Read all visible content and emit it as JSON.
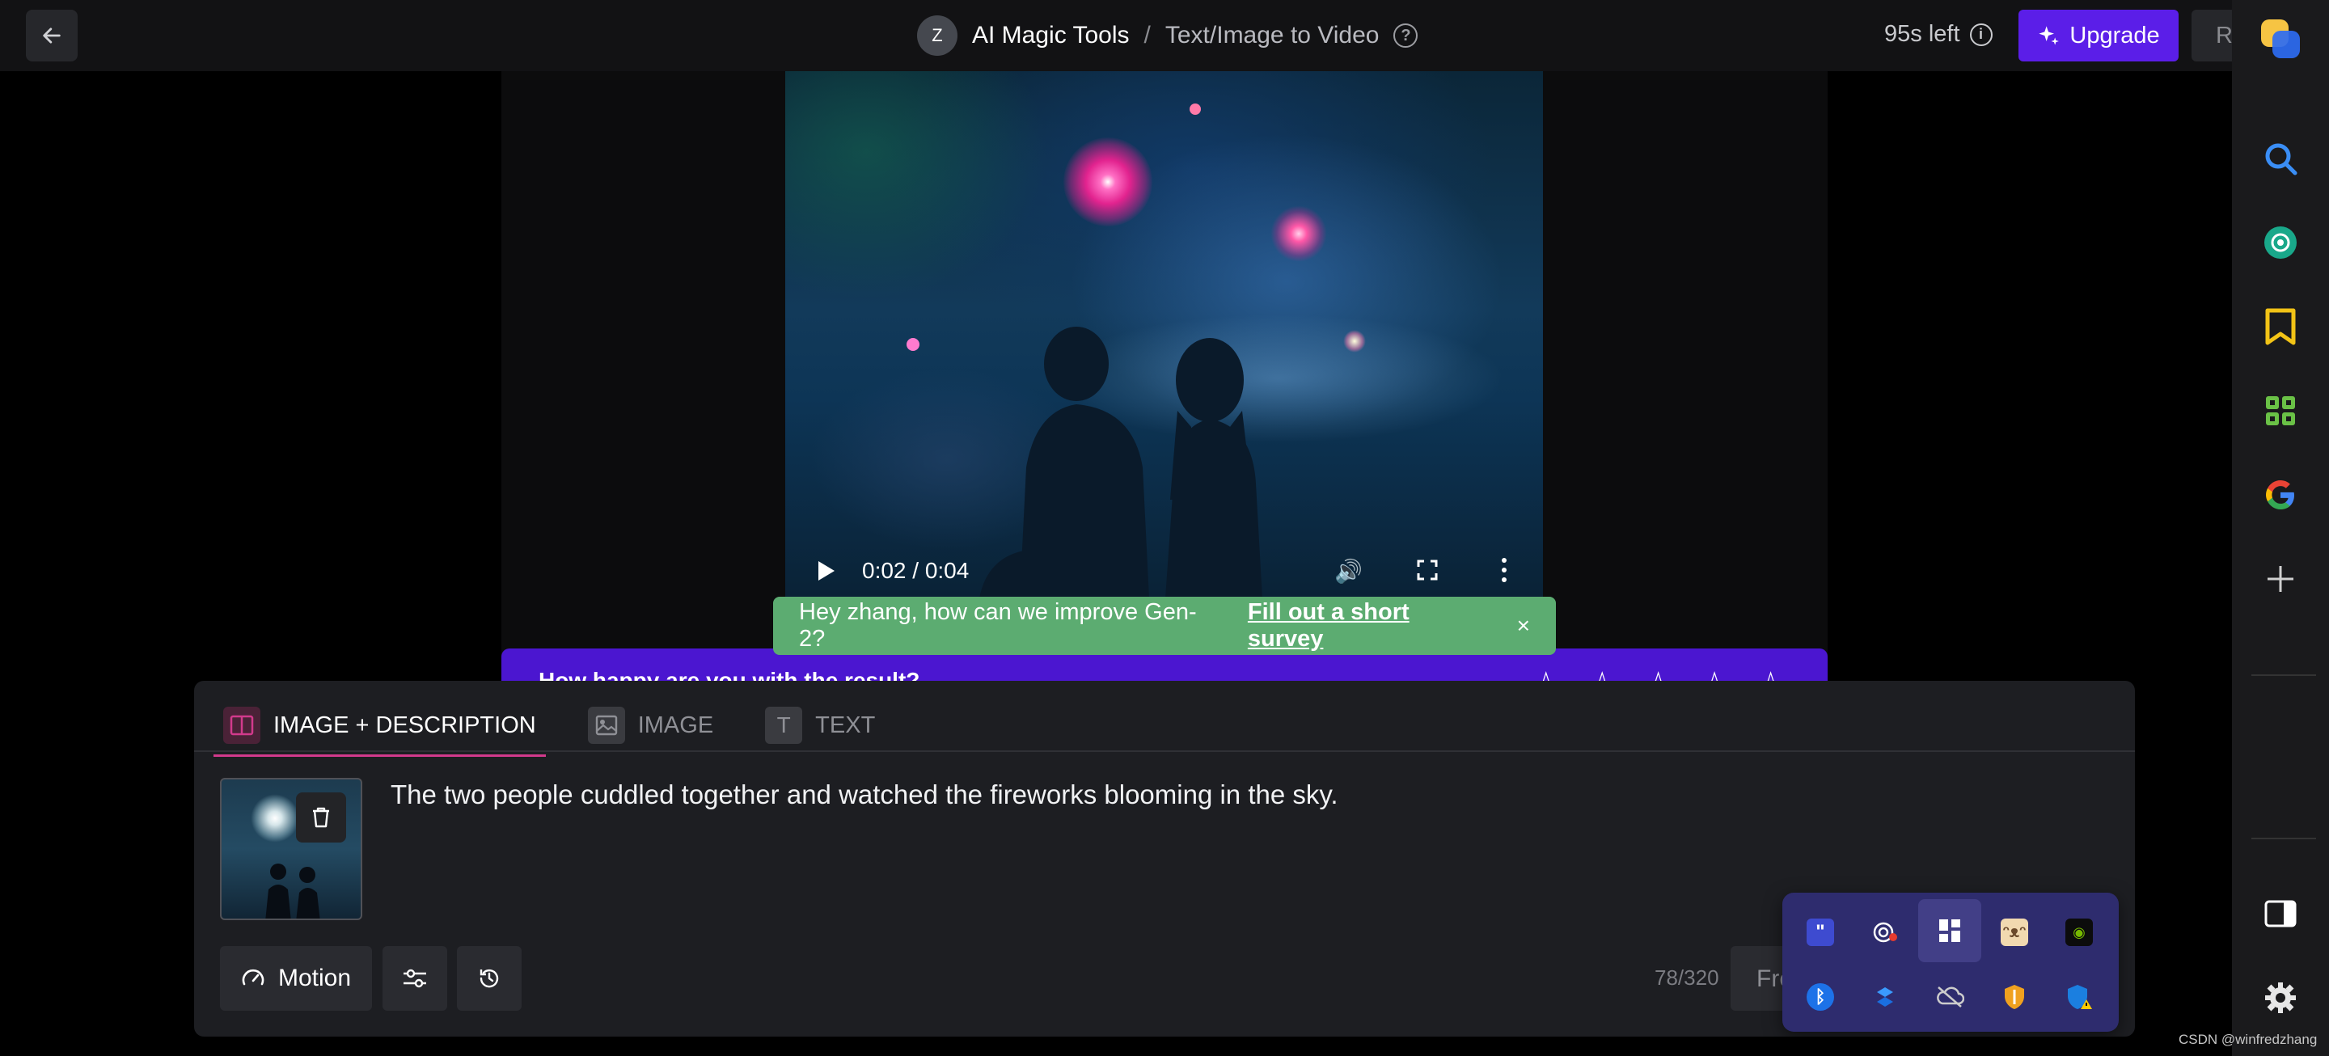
{
  "topbar": {
    "avatar_letter": "Z",
    "app_name": "AI Magic Tools",
    "separator": "/",
    "page_name": "Text/Image to Video",
    "credits_left": "95s left",
    "upgrade_label": "Upgrade",
    "right_button_label": "R"
  },
  "video": {
    "time": "0:02 / 0:04"
  },
  "toast": {
    "message": "Hey zhang, how can we improve Gen-2?",
    "link": "Fill out a short survey",
    "close": "×"
  },
  "rating": {
    "question": "How happy are you with the result?",
    "stars": [
      "☆",
      "☆",
      "☆",
      "☆",
      "☆"
    ]
  },
  "prompt_panel": {
    "tabs": [
      {
        "label": "IMAGE + DESCRIPTION",
        "active": true
      },
      {
        "label": "IMAGE",
        "active": false
      },
      {
        "label": "TEXT",
        "active": false
      }
    ],
    "prompt": "The two people cuddled together and watched the fireworks blooming in the sky.",
    "motion_label": "Motion",
    "char_counter": "78/320",
    "free_button_label": "Fre"
  },
  "tray": {
    "icons": [
      "quote-app-icon",
      "recorder-icon",
      "pinned-app-icon",
      "cat-app-icon",
      "nvidia-icon",
      "bluetooth-icon",
      "dropbox-icon",
      "cloud-offline-icon",
      "security-shield-icon",
      "defender-warning-icon"
    ]
  },
  "sidebar": {
    "items": [
      "search-icon",
      "chatgpt-icon",
      "bookmark-icon",
      "apps-grid-icon",
      "google-icon",
      "add-icon"
    ],
    "bottom": [
      "sidebar-toggle-icon",
      "settings-icon"
    ]
  },
  "watermark": "CSDN @winfredzhang",
  "colors": {
    "accent_purple": "#5b1ee8",
    "toast_green": "#5cac71",
    "tab_active_underline": "#d23a8c"
  }
}
